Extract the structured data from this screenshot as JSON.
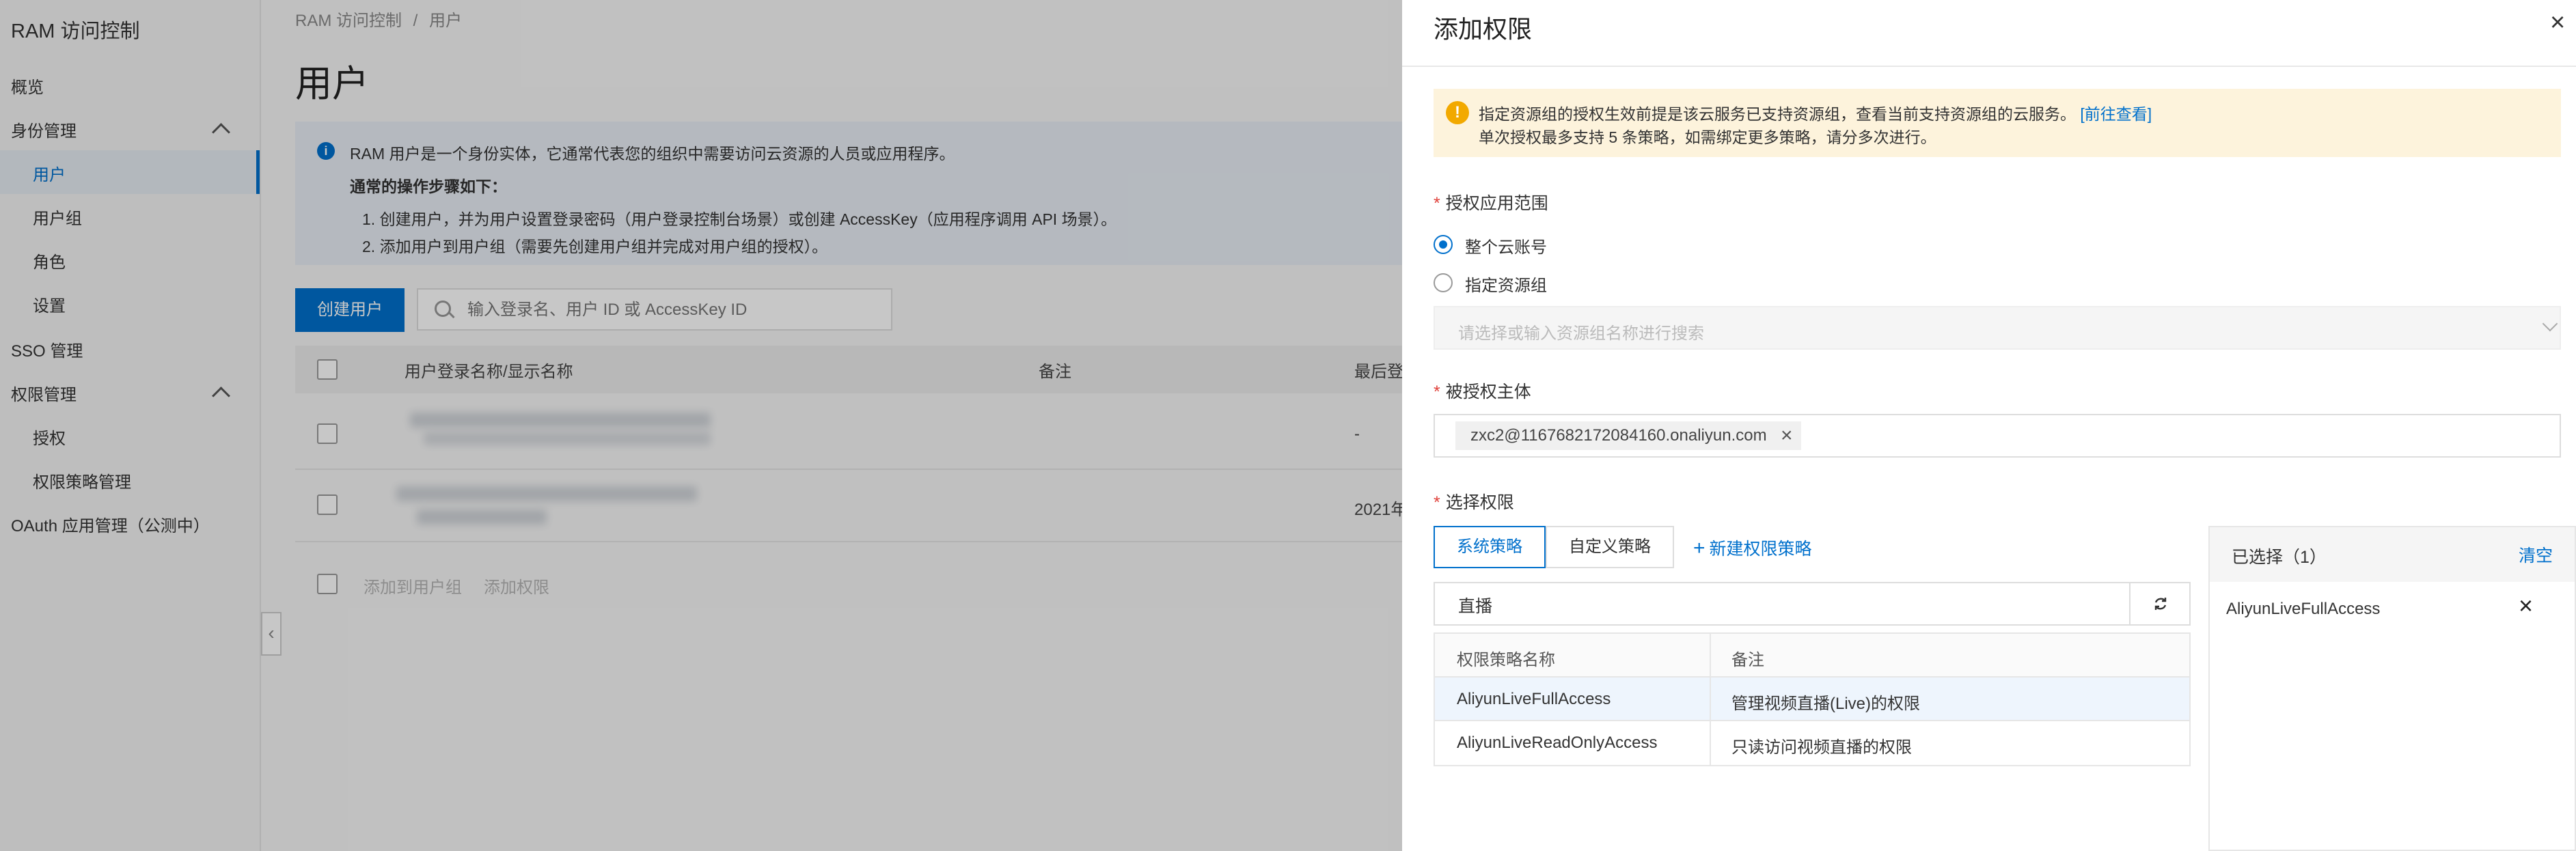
{
  "sidebar": {
    "title": "RAM 访问控制",
    "items": [
      {
        "label": "概览"
      },
      {
        "label": "身份管理"
      },
      {
        "label": "用户"
      },
      {
        "label": "用户组"
      },
      {
        "label": "角色"
      },
      {
        "label": "设置"
      },
      {
        "label": "SSO 管理"
      },
      {
        "label": "权限管理"
      },
      {
        "label": "授权"
      },
      {
        "label": "权限策略管理"
      },
      {
        "label": "OAuth 应用管理（公测中）"
      }
    ],
    "collapse_icon": "‹"
  },
  "breadcrumb": {
    "root": "RAM 访问控制",
    "sep": "/",
    "current": "用户"
  },
  "page": {
    "title": "用户",
    "info": {
      "line1": "RAM 用户是一个身份实体，它通常代表您的组织中需要访问云资源的人员或应用程序。",
      "line2": "通常的操作步骤如下：",
      "line3": "1. 创建用户，并为用户设置登录密码（用户登录控制台场景）或创建 AccessKey（应用程序调用 API 场景）。",
      "line4": "2. 添加用户到用户组（需要先创建用户组并完成对用户组的授权）。"
    },
    "create_button": "创建用户",
    "search_placeholder": "输入登录名、用户 ID 或 AccessKey ID",
    "table": {
      "columns": [
        "用户登录名称/显示名称",
        "备注",
        "最后登"
      ],
      "rows": [
        {
          "last_login": "-"
        },
        {
          "last_login": "2021年"
        }
      ]
    },
    "footer": {
      "add_to_group": "添加到用户组",
      "add_permission": "添加权限"
    }
  },
  "drawer": {
    "title": "添加权限",
    "close_icon": "×",
    "warning": {
      "line1": "指定资源组的授权生效前提是该云服务已支持资源组，查看当前支持资源组的云服务。",
      "link": "[前往查看]",
      "line2": "单次授权最多支持 5 条策略，如需绑定更多策略，请分多次进行。"
    },
    "scope": {
      "label": "授权应用范围",
      "option_account": "整个云账号",
      "option_group": "指定资源组",
      "selected": "整个云账号",
      "group_placeholder": "请选择或输入资源组名称进行搜索"
    },
    "principal": {
      "label": "被授权主体",
      "value": "zxc2@1167682172084160.onaliyun.com"
    },
    "policy": {
      "label": "选择权限",
      "tab_system": "系统策略",
      "tab_custom": "自定义策略",
      "new_policy": "新建权限策略",
      "search_value": "直播",
      "columns": [
        "权限策略名称",
        "备注"
      ],
      "rows": [
        {
          "name": "AliyunLiveFullAccess",
          "note": "管理视频直播(Live)的权限",
          "selected": true
        },
        {
          "name": "AliyunLiveReadOnlyAccess",
          "note": "只读访问视频直播的权限",
          "selected": false
        }
      ]
    },
    "selected": {
      "title": "已选择（1）",
      "clear": "清空",
      "items": [
        "AliyunLiveFullAccess"
      ]
    }
  },
  "colors": {
    "accent": "#0070cc",
    "warning": "#f2a900",
    "warning_bg": "#fdf3dc"
  }
}
